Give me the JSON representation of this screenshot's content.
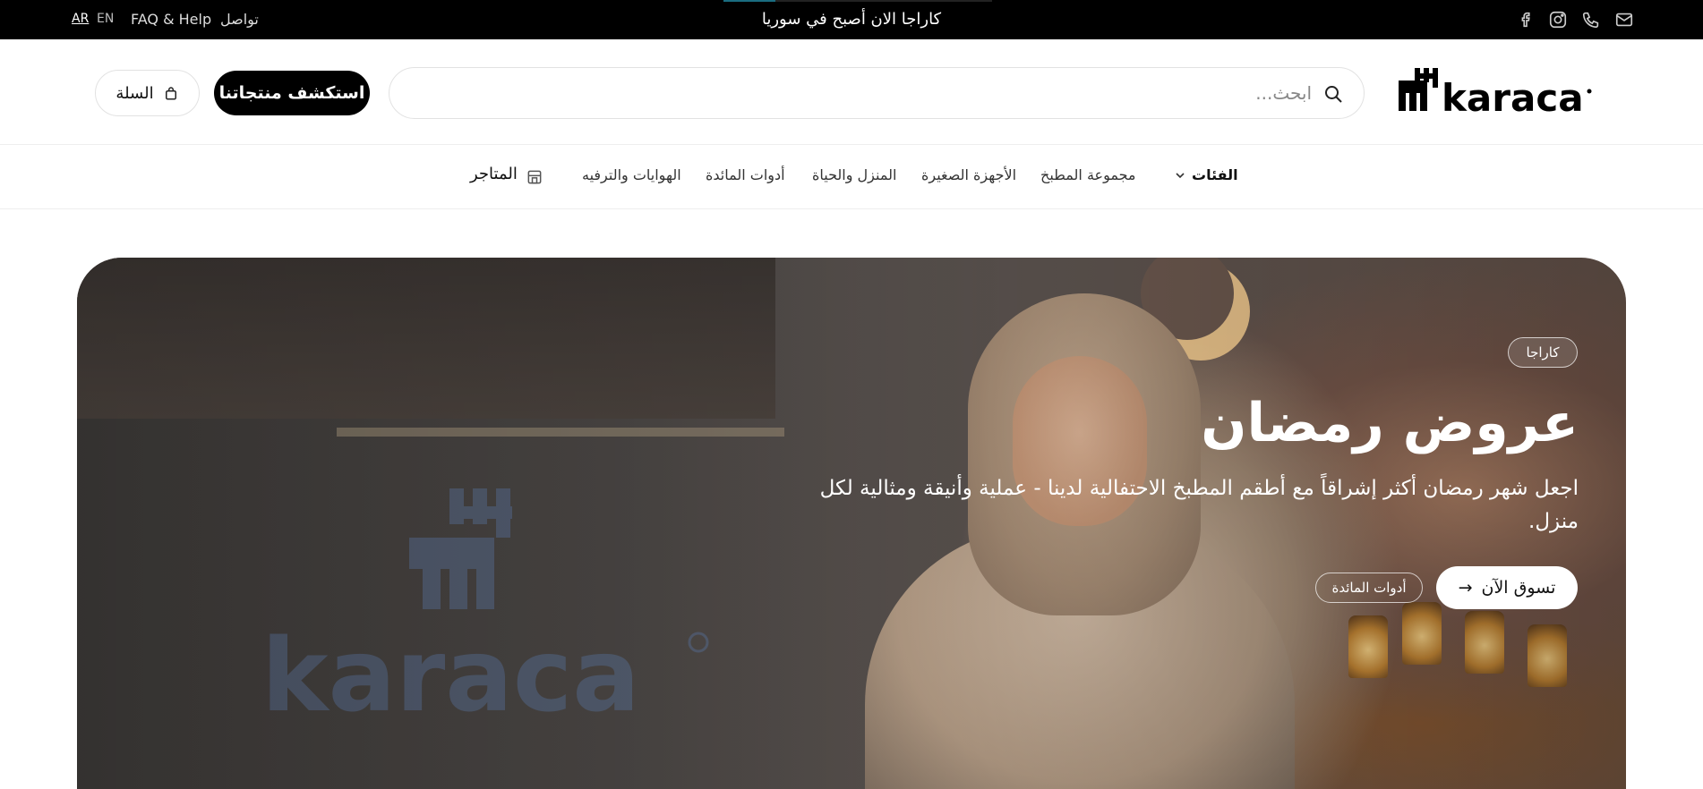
{
  "topbar": {
    "announcement": "كاراجا الان أصبح في سوريا",
    "lang_ar": "AR",
    "lang_en": "EN",
    "faq": "FAQ & Help",
    "contact": "تواصل",
    "icons": [
      "facebook-icon",
      "instagram-icon",
      "phone-icon",
      "mail-icon"
    ]
  },
  "header": {
    "logo_text": "karaca",
    "search_placeholder": "ابحث...",
    "explore_button": "استكشف منتجاتنا",
    "cart_label": "السلة"
  },
  "nav": {
    "categories": "الفئات",
    "items": [
      "مجموعة المطبخ",
      "الأجهزة الصغيرة",
      "المنزل والحياة",
      "أدوات المائدة",
      "الهوايات والترفيه"
    ],
    "stores": "المتاجر"
  },
  "hero": {
    "badge": "كاراجا",
    "title": "عروض رمضان",
    "description": "اجعل شهر رمضان أكثر إشراقاً مع أطقم المطبخ الاحتفالية لدينا - عملية وأنيقة ومثالية لكل منزل.",
    "cta_primary": "تسوق الآن",
    "cta_primary_arrow": "→",
    "cta_secondary": "أدوات المائدة",
    "watermark_text": "karaca"
  },
  "colors": {
    "topbar_bg": "#000000",
    "accent_progress": "#1a6c80",
    "button_dark": "#000000",
    "page_bg": "#ffffff"
  }
}
